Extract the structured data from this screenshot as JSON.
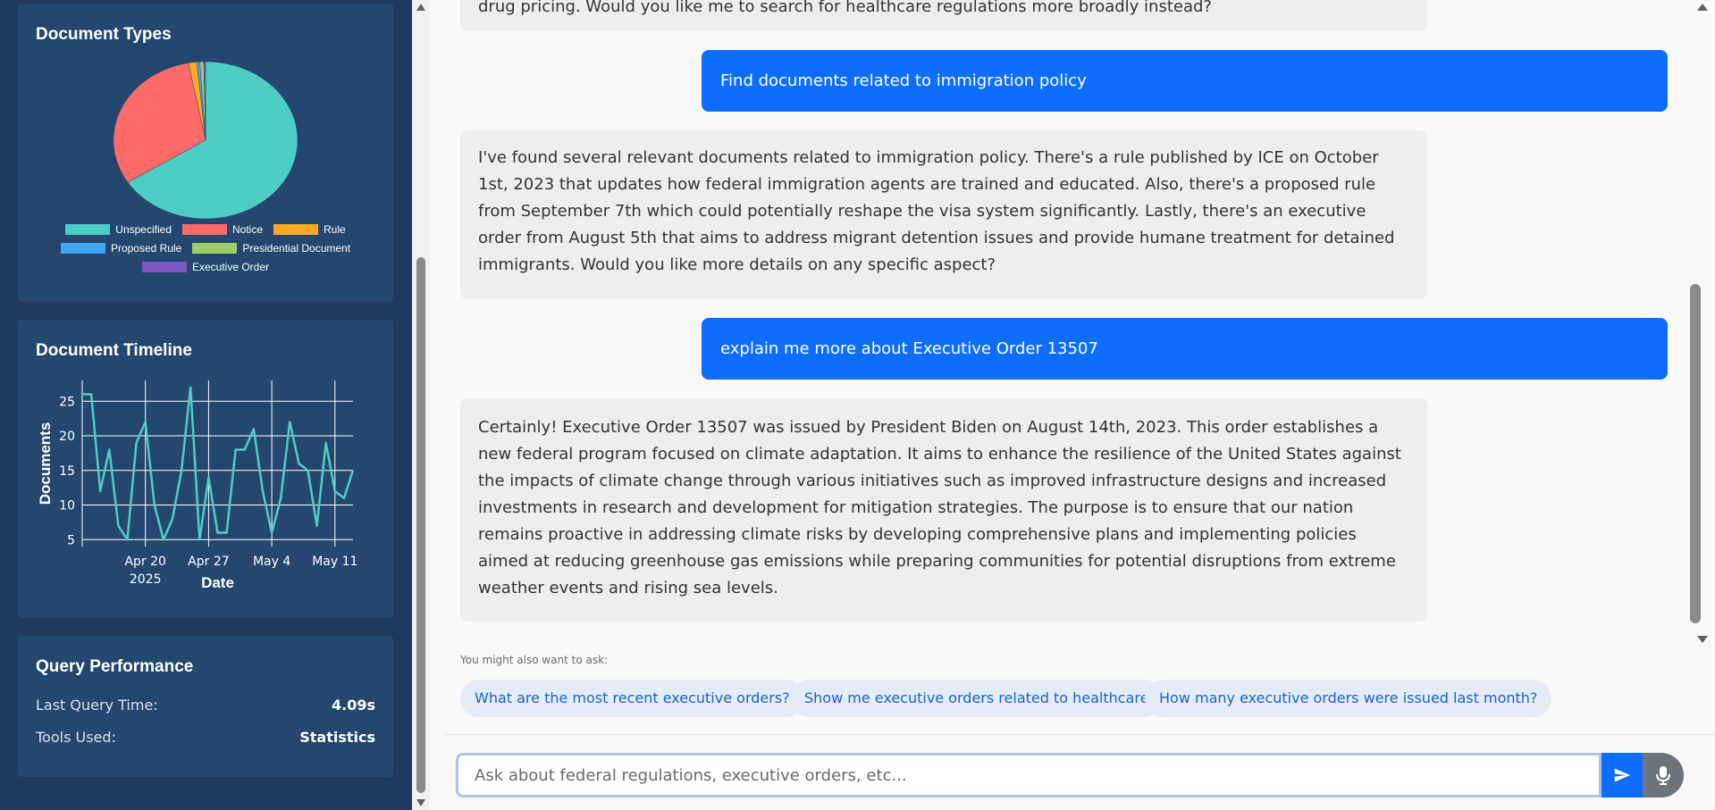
{
  "sidebar": {
    "document_types": {
      "title": "Document Types",
      "legend": [
        {
          "label": "Unspecified",
          "color": "#4ecdc4"
        },
        {
          "label": "Notice",
          "color": "#ff6b6b"
        },
        {
          "label": "Rule",
          "color": "#f9a825"
        },
        {
          "label": "Proposed Rule",
          "color": "#42a5f5"
        },
        {
          "label": "Presidential Document",
          "color": "#9ccc65"
        },
        {
          "label": "Executive Order",
          "color": "#7e57c2"
        }
      ]
    },
    "timeline": {
      "title": "Document Timeline"
    },
    "performance": {
      "title": "Query Performance",
      "rows": [
        {
          "label": "Last Query Time:",
          "value": "4.09s"
        },
        {
          "label": "Tools Used:",
          "value": "Statistics"
        }
      ]
    }
  },
  "chart_data": [
    {
      "type": "pie",
      "title": "Document Types",
      "labels": [
        "Unspecified",
        "Notice",
        "Rule",
        "Proposed Rule",
        "Presidential Document",
        "Executive Order"
      ],
      "values": [
        66,
        31,
        1.5,
        0.5,
        0.7,
        0.3
      ],
      "colors": [
        "#4ecdc4",
        "#ff6b6b",
        "#f9a825",
        "#42a5f5",
        "#9ccc65",
        "#7e57c2"
      ],
      "legend": "bottom"
    },
    {
      "type": "line",
      "title": "Document Timeline",
      "xlabel": "Date",
      "ylabel": "Documents",
      "x_start": "2025-04-13",
      "x_ticks": [
        "Apr 20",
        "Apr 27",
        "May 4",
        "May 11"
      ],
      "x_tick_sub": "2025",
      "y_ticks": [
        5,
        10,
        15,
        20,
        25
      ],
      "ylim": [
        4,
        28
      ],
      "grid": true,
      "color": "#4ecdc4",
      "values": [
        26,
        26,
        12,
        18,
        7,
        5,
        19,
        22,
        10,
        5,
        8,
        15,
        27,
        5,
        14,
        6,
        6,
        18,
        18,
        21,
        12,
        6,
        11,
        22,
        16,
        15,
        7,
        19,
        12,
        11,
        15
      ]
    }
  ],
  "chat": {
    "partial_top": "drug pricing. Would you like me to search for healthcare regulations more broadly instead?",
    "messages": [
      {
        "role": "user",
        "text": "Find documents related to immigration policy"
      },
      {
        "role": "bot",
        "text": "I've found several relevant documents related to immigration policy. There's a rule published by ICE on October 1st, 2023 that updates how federal immigration agents are trained and educated. Also, there's a proposed rule from September 7th which could potentially reshape the visa system significantly. Lastly, there's an executive order from August 5th that aims to address migrant detention issues and provide humane treatment for detained immigrants. Would you like more details on any specific aspect?"
      },
      {
        "role": "user",
        "text": "explain me more about Executive Order 13507"
      },
      {
        "role": "bot",
        "text": "Certainly! Executive Order 13507 was issued by President Biden on August 14th, 2023. This order establishes a new federal program focused on climate adaptation. It aims to enhance the resilience of the United States against the impacts of climate change through various initiatives such as improved infrastructure designs and increased investments in research and development for mitigation strategies. The purpose is to ensure that our nation remains proactive in addressing climate risks by developing comprehensive plans and implementing policies aimed at reducing greenhouse gas emissions while preparing communities for potential disruptions from extreme weather events and rising sea levels."
      }
    ],
    "suggestions_label": "You might also want to ask:",
    "suggestions": [
      "What are the most recent executive orders?",
      "Show me executive orders related to healthcare",
      "How many executive orders were issued last month?"
    ],
    "input_placeholder": "Ask about federal regulations, executive orders, etc..."
  }
}
